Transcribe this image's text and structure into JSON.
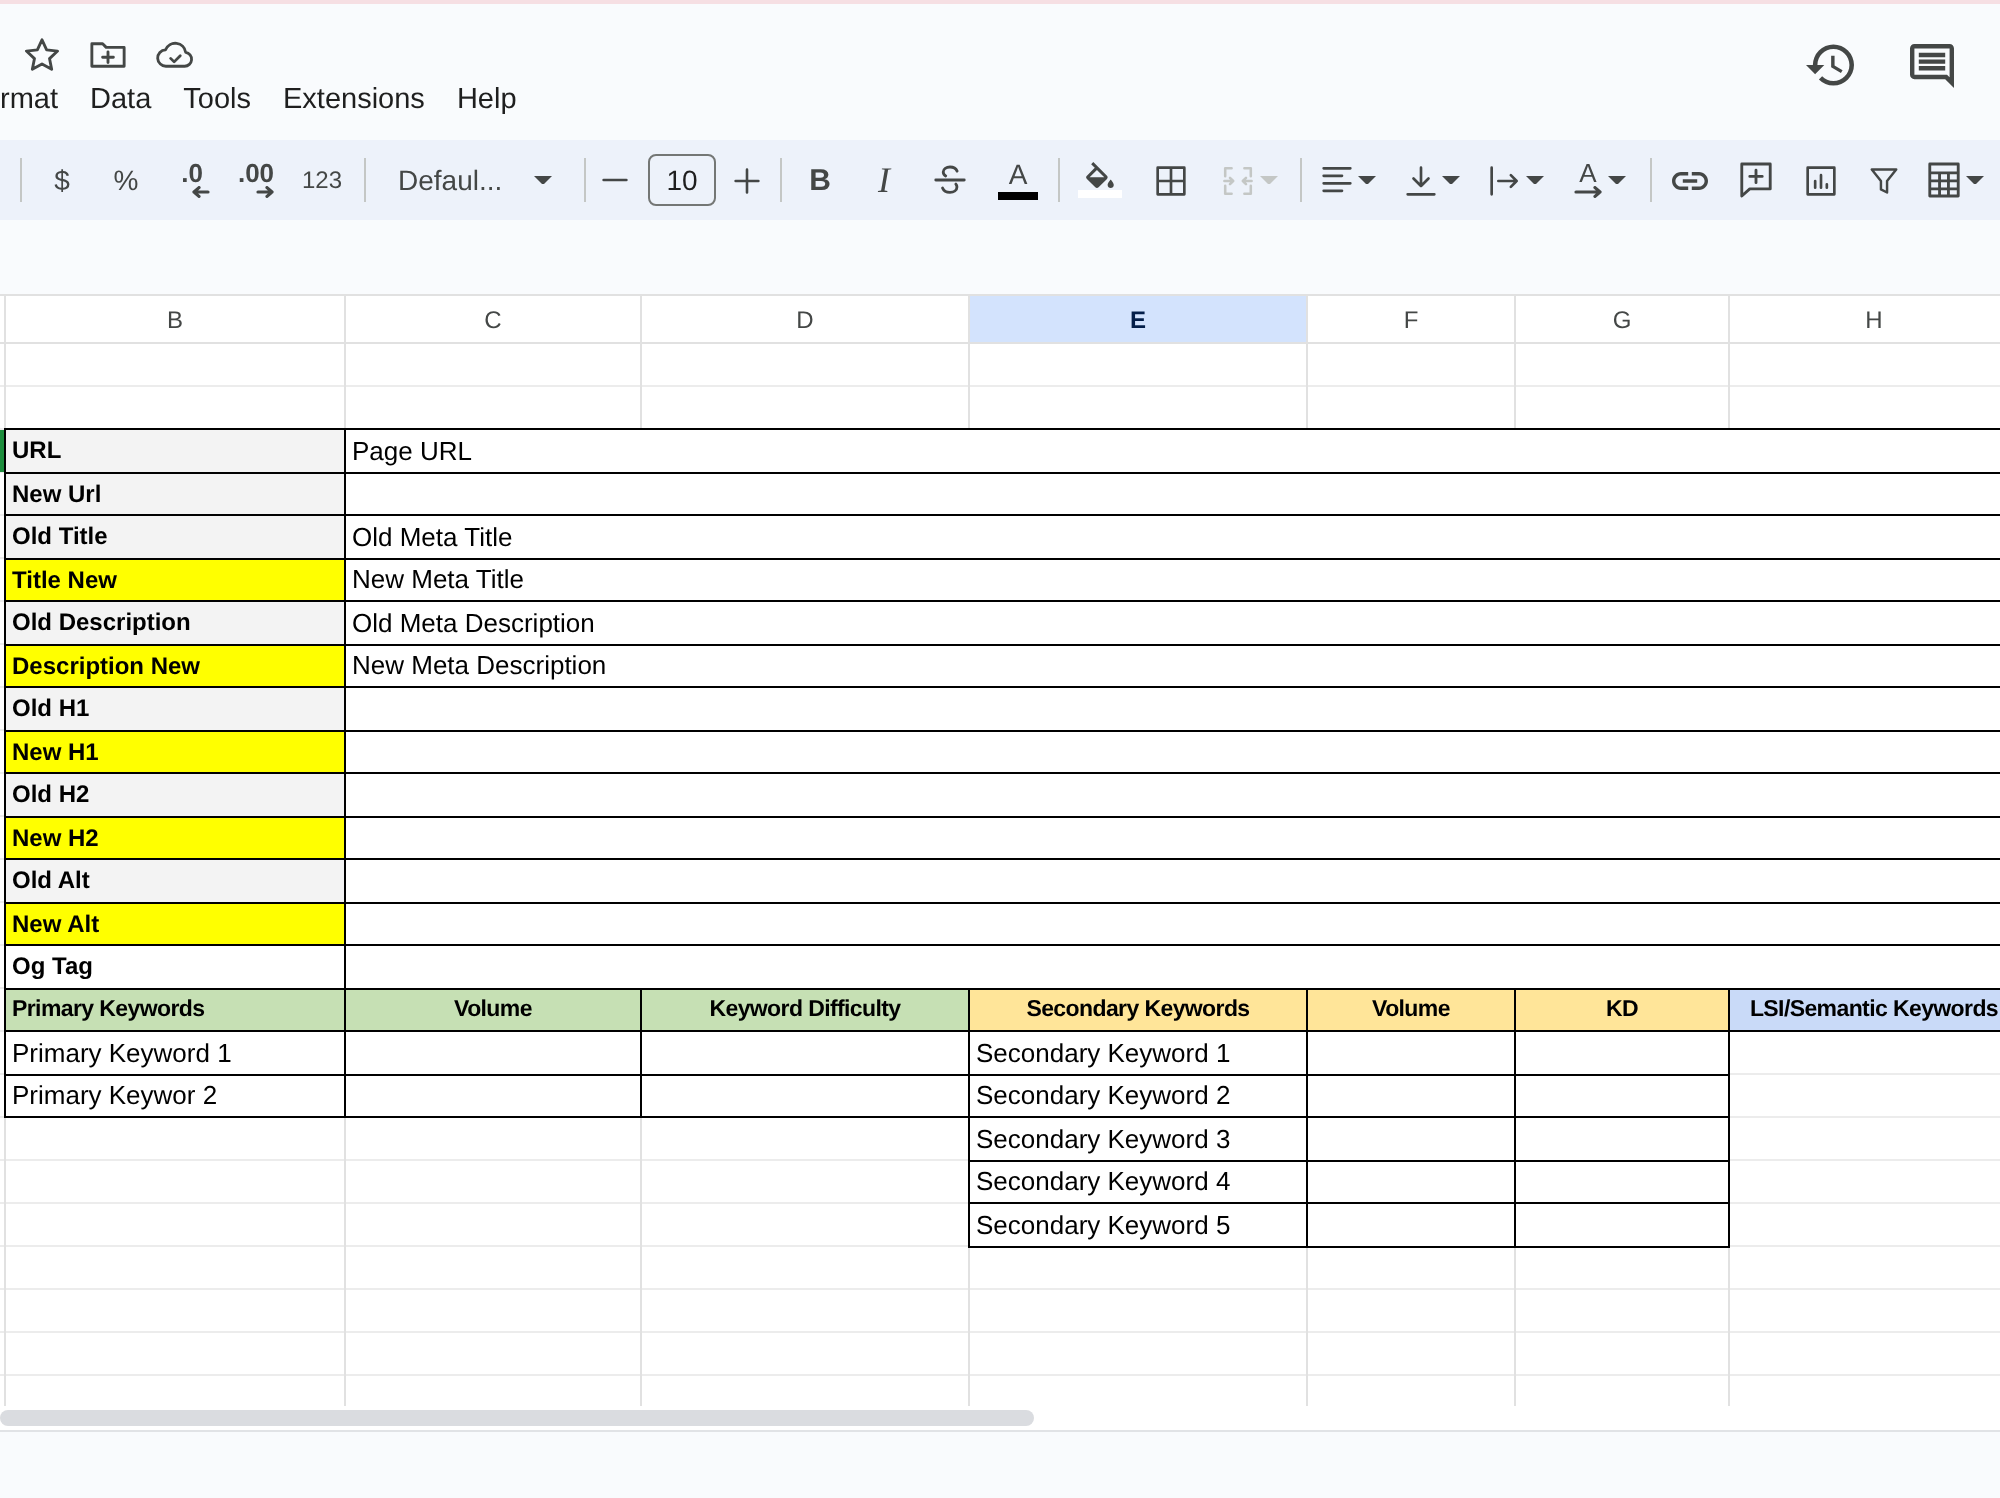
{
  "menu": [
    "rmat",
    "Data",
    "Tools",
    "Extensions",
    "Help"
  ],
  "toolbar": {
    "currency": "$",
    "percent": "%",
    "decrease_decimal": ".0",
    "increase_decimal": ".00",
    "number_format": "123",
    "font": "Defaul...",
    "font_size": "10",
    "bold": "B",
    "italic": "I",
    "text_color": "A",
    "text_rotation": "A",
    "merge": {
      "disabled": true
    }
  },
  "columns": [
    {
      "label": "B",
      "selected": false
    },
    {
      "label": "C",
      "selected": false
    },
    {
      "label": "D",
      "selected": false
    },
    {
      "label": "E",
      "selected": true
    },
    {
      "label": "F",
      "selected": false
    },
    {
      "label": "G",
      "selected": false
    },
    {
      "label": "H",
      "selected": false
    }
  ],
  "fields": [
    {
      "label": "URL",
      "value": "Page URL",
      "color": "#f3f3f3",
      "collaborator_cursor": true
    },
    {
      "label": "New Url",
      "color": "#f3f3f3",
      "collaborator_cursor": false
    },
    {
      "label": "Old Title",
      "value": "Old Meta Title",
      "color": "#f3f3f3",
      "collaborator_cursor": false
    },
    {
      "label": "Title New",
      "value": "New Meta Title",
      "color": "#ffff00",
      "collaborator_cursor": false
    },
    {
      "label": "Old Description",
      "value": "Old Meta Description",
      "color": "#f3f3f3",
      "collaborator_cursor": false
    },
    {
      "label": "Description New",
      "value": "New Meta Description",
      "color": "#ffff00",
      "collaborator_cursor": false
    },
    {
      "label": "Old H1",
      "color": "#f3f3f3",
      "collaborator_cursor": false
    },
    {
      "label": "New H1",
      "color": "#ffff00",
      "collaborator_cursor": false
    },
    {
      "label": "Old H2",
      "color": "#f3f3f3",
      "collaborator_cursor": false
    },
    {
      "label": "New H2",
      "color": "#ffff00",
      "collaborator_cursor": false
    },
    {
      "label": "Old Alt",
      "color": "#f3f3f3",
      "collaborator_cursor": false
    },
    {
      "label": "New Alt",
      "color": "#ffff00",
      "collaborator_cursor": false
    },
    {
      "label": "Og Tag",
      "color": "#ffffff",
      "collaborator_cursor": false
    }
  ],
  "keyword_headers": [
    {
      "label": "Primary Keywords",
      "color": "#c6e0b4"
    },
    {
      "label": "Volume",
      "color": "#c6e0b4"
    },
    {
      "label": "Keyword Difficulty",
      "color": "#c6e0b4"
    },
    {
      "label": "Secondary Keywords",
      "color": "#ffe599"
    },
    {
      "label": "Volume",
      "color": "#ffe599"
    },
    {
      "label": "KD",
      "color": "#ffe599"
    },
    {
      "label": "LSI/Semantic Keywords",
      "color": "#c9daf8"
    }
  ],
  "primary_keywords": [
    {
      "keyword": "Primary Keyword 1"
    },
    {
      "keyword": "Primary Keywor 2"
    }
  ],
  "secondary_keywords": [
    {
      "keyword": "Secondary Keyword 1"
    },
    {
      "keyword": "Secondary Keyword 2"
    },
    {
      "keyword": "Secondary Keyword 3"
    },
    {
      "keyword": "Secondary Keyword 4"
    },
    {
      "keyword": "Secondary Keyword 5"
    }
  ]
}
